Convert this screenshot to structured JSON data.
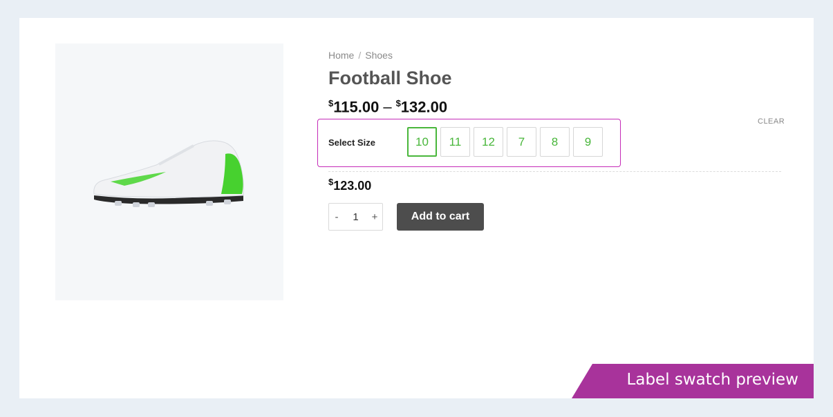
{
  "breadcrumb": {
    "home": "Home",
    "separator": "/",
    "current": "Shoes"
  },
  "product": {
    "title": "Football Shoe",
    "currency": "$",
    "price_min": "115.00",
    "price_max": "132.00",
    "price_dash": "–",
    "selected_price": "123.00",
    "image_icon": "football-shoe-image"
  },
  "variations": {
    "label": "Select Size",
    "clear_label": "CLEAR",
    "sizes": [
      "10",
      "11",
      "12",
      "7",
      "8",
      "9"
    ],
    "selected": "10"
  },
  "cart": {
    "minus": "-",
    "quantity": "1",
    "plus": "+",
    "add_label": "Add to cart"
  },
  "banner": {
    "text": "Label swatch preview"
  },
  "colors": {
    "accent_green": "#48b63a",
    "highlight_magenta": "#c42ab7",
    "banner_purple": "#a8339b",
    "button_dark": "#4d4d4d"
  }
}
